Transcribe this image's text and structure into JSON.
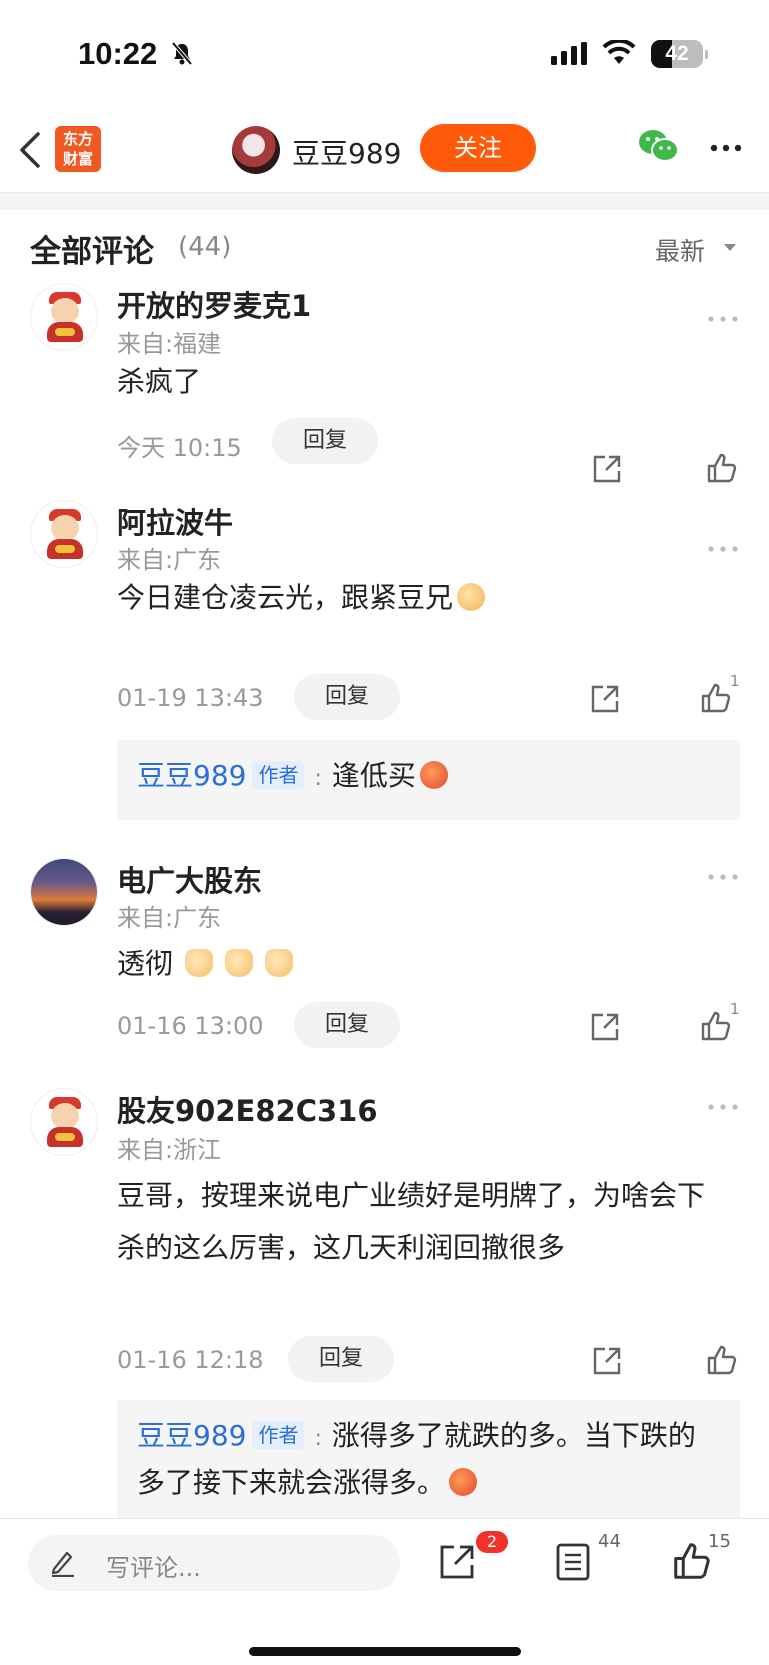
{
  "status_bar": {
    "time": "10:22",
    "battery": "42"
  },
  "nav": {
    "logo_text": "东方\n财富",
    "author_name": "豆豆989",
    "follow_label": "关注"
  },
  "comments_header": {
    "title": "全部评论",
    "count": "(44)",
    "sort": "最新"
  },
  "comments": [
    {
      "name": "开放的罗麦克1",
      "location": "来自:福建",
      "text": "杀疯了",
      "time": "今天 10:15",
      "reply_label": "回复",
      "likes": ""
    },
    {
      "name": "阿拉波牛",
      "location": "来自:广东",
      "text": "今日建仓凌云光，跟紧豆兄",
      "time": "01-19 13:43",
      "reply_label": "回复",
      "likes": "1",
      "sub_reply": {
        "author": "豆豆989",
        "tag": "作者",
        "sep": ":",
        "text": "逢低买"
      }
    },
    {
      "name": "电广大股东",
      "location": "来自:广东",
      "text": "透彻",
      "time": "01-16 13:00",
      "reply_label": "回复",
      "likes": "1"
    },
    {
      "name": "股友902E82C316",
      "location": "来自:浙江",
      "text": "豆哥，按理来说电广业绩好是明牌了，为啥会下杀的这么厉害，这几天利润回撤很多",
      "time": "01-16 12:18",
      "reply_label": "回复",
      "likes": "",
      "sub_reply": {
        "author": "豆豆989",
        "tag": "作者",
        "sep": ":",
        "text": "涨得多了就跌的多。当下跌的多了接下来就会涨得多。"
      }
    }
  ],
  "bottom_bar": {
    "placeholder": "写评论...",
    "share_badge": "2",
    "comment_count": "44",
    "like_count": "15"
  },
  "icons": [
    "back-icon",
    "mute-icon",
    "signal-icon",
    "wifi-icon",
    "battery-icon",
    "wechat-icon",
    "more-icon",
    "share-icon",
    "thumbs-up-icon",
    "pen-icon",
    "comment-list-icon"
  ],
  "colors": {
    "accent": "#ff5a0a",
    "author_blue": "#2a6fd6",
    "badge_red": "#f0322a"
  }
}
